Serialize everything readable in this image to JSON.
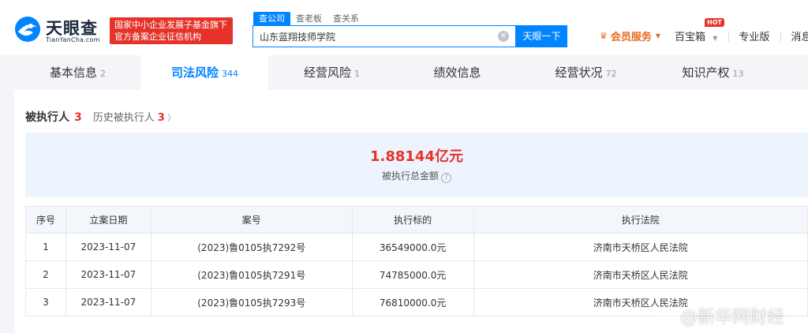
{
  "header": {
    "logo_cn": "天眼查",
    "logo_en": "TianYanCha.com",
    "gov_badge_line1": "国家中小企业发展子基金旗下",
    "gov_badge_line2": "官方备案企业征信机构",
    "search_tabs": [
      "查公司",
      "查老板",
      "查关系"
    ],
    "search_value": "山东蓝翔技师学院",
    "search_button": "天眼一下",
    "member_label": "会员服务",
    "treasure_label": "百宝箱",
    "hot_label": "HOT",
    "pro_label": "专业版",
    "news_label": "消息"
  },
  "tabs": [
    {
      "label": "基本信息",
      "count": "2"
    },
    {
      "label": "司法风险",
      "count": "344"
    },
    {
      "label": "经营风险",
      "count": "1"
    },
    {
      "label": "绩效信息",
      "count": ""
    },
    {
      "label": "经营状况",
      "count": "72"
    },
    {
      "label": "知识产权",
      "count": "13"
    }
  ],
  "section": {
    "title": "被执行人",
    "count": "3",
    "history_label": "历史被执行人",
    "history_count": "3"
  },
  "summary": {
    "amount": "1.88144亿元",
    "label": "被执行总金额"
  },
  "table": {
    "headers": [
      "序号",
      "立案日期",
      "案号",
      "执行标的",
      "执行法院"
    ],
    "rows": [
      [
        "1",
        "2023-11-07",
        "(2023)鲁0105执7292号",
        "36549000.0元",
        "济南市天桥区人民法院"
      ],
      [
        "2",
        "2023-11-07",
        "(2023)鲁0105执7291号",
        "74785000.0元",
        "济南市天桥区人民法院"
      ],
      [
        "3",
        "2023-11-07",
        "(2023)鲁0105执7293号",
        "76810000.0元",
        "济南市天桥区人民法院"
      ]
    ]
  },
  "watermark": "@新华网财经",
  "colors": {
    "accent": "#0084ff",
    "danger": "#e5332a",
    "member": "#e86a1f"
  }
}
